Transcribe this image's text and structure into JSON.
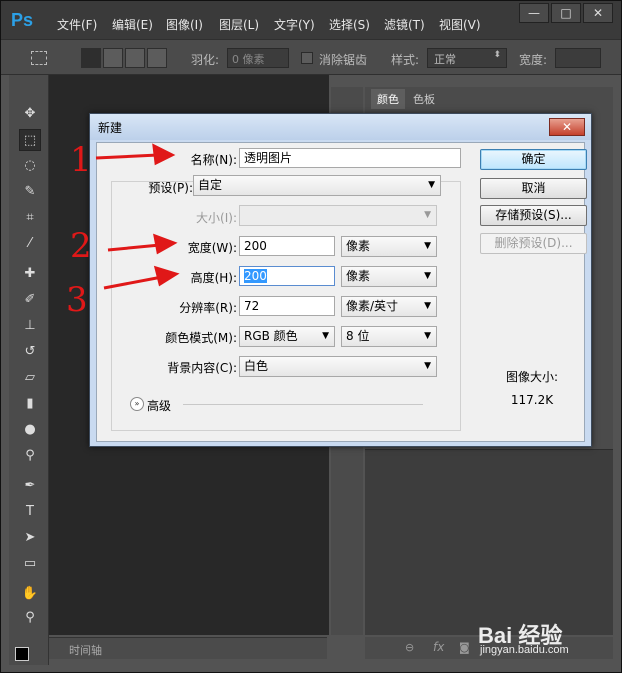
{
  "app": {
    "logo": "Ps"
  },
  "menu": [
    {
      "label": "文件(F)"
    },
    {
      "label": "编辑(E)"
    },
    {
      "label": "图像(I)"
    },
    {
      "label": "图层(L)"
    },
    {
      "label": "文字(Y)"
    },
    {
      "label": "选择(S)"
    },
    {
      "label": "滤镜(T)"
    },
    {
      "label": "视图(V)"
    }
  ],
  "window_buttons": {
    "minimize": "—",
    "maximize": "□",
    "close": "✕"
  },
  "options_bar": {
    "feather_label": "羽化:",
    "feather_value": "0 像素",
    "antialias_label": "消除锯齿",
    "style_label": "样式:",
    "style_value": "正常",
    "width_label": "宽度:"
  },
  "panels": {
    "tab_color": "颜色",
    "tab_swatches": "色板"
  },
  "timeline": {
    "label": "时间轴"
  },
  "dialog": {
    "title": "新建",
    "close": "✕",
    "name_label": "名称(N):",
    "name_value": "透明图片",
    "preset_label": "预设(P):",
    "preset_value": "自定",
    "size_label": "大小(I):",
    "width_label": "宽度(W):",
    "width_value": "200",
    "width_unit": "像素",
    "height_label": "高度(H):",
    "height_value": "200",
    "height_unit": "像素",
    "resolution_label": "分辨率(R):",
    "resolution_value": "72",
    "resolution_unit": "像素/英寸",
    "color_mode_label": "颜色模式(M):",
    "color_mode_value": "RGB 颜色",
    "bit_depth_value": "8 位",
    "background_label": "背景内容(C):",
    "background_value": "白色",
    "advanced_label": "高级",
    "ok_button": "确定",
    "cancel_button": "取消",
    "save_preset_button": "存储预设(S)...",
    "delete_preset_button": "删除预设(D)...",
    "image_size_label": "图像大小:",
    "image_size_value": "117.2K"
  },
  "annotations": [
    "1",
    "2",
    "3"
  ],
  "watermark": {
    "brand": "Bai 经验",
    "url": "jingyan.baidu.com"
  },
  "colors": {
    "accent_red": "#e01818",
    "ps_blue": "#2ca0e6"
  }
}
